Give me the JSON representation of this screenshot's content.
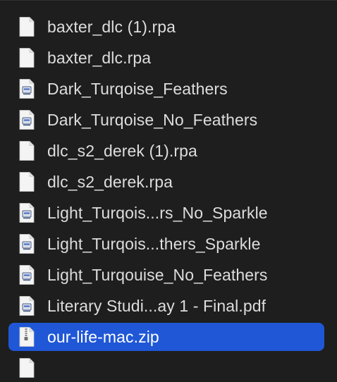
{
  "files": [
    {
      "name": "baxter_dlc (1).rpa",
      "icon": "blank-document-icon"
    },
    {
      "name": "baxter_dlc.rpa",
      "icon": "blank-document-icon"
    },
    {
      "name": "Dark_Turqoise_Feathers",
      "icon": "application-document-icon"
    },
    {
      "name": "Dark_Turqoise_No_Feathers",
      "icon": "application-document-icon"
    },
    {
      "name": "dlc_s2_derek (1).rpa",
      "icon": "blank-document-icon"
    },
    {
      "name": "dlc_s2_derek.rpa",
      "icon": "blank-document-icon"
    },
    {
      "name": "Light_Turqois...rs_No_Sparkle",
      "icon": "application-document-icon"
    },
    {
      "name": "Light_Turqois...thers_Sparkle",
      "icon": "application-document-icon"
    },
    {
      "name": "Light_Turqouise_No_Feathers",
      "icon": "application-document-icon"
    },
    {
      "name": "Literary Studi...ay 1 - Final.pdf",
      "icon": "application-document-icon"
    },
    {
      "name": "our-life-mac.zip",
      "icon": "zip-archive-icon",
      "selected": true
    },
    {
      "name": "",
      "icon": "blank-document-icon"
    }
  ],
  "colors": {
    "background": "#1e1e1e",
    "selection": "#1f57d6",
    "text": "#dddddd",
    "selected_text": "#ffffff"
  }
}
